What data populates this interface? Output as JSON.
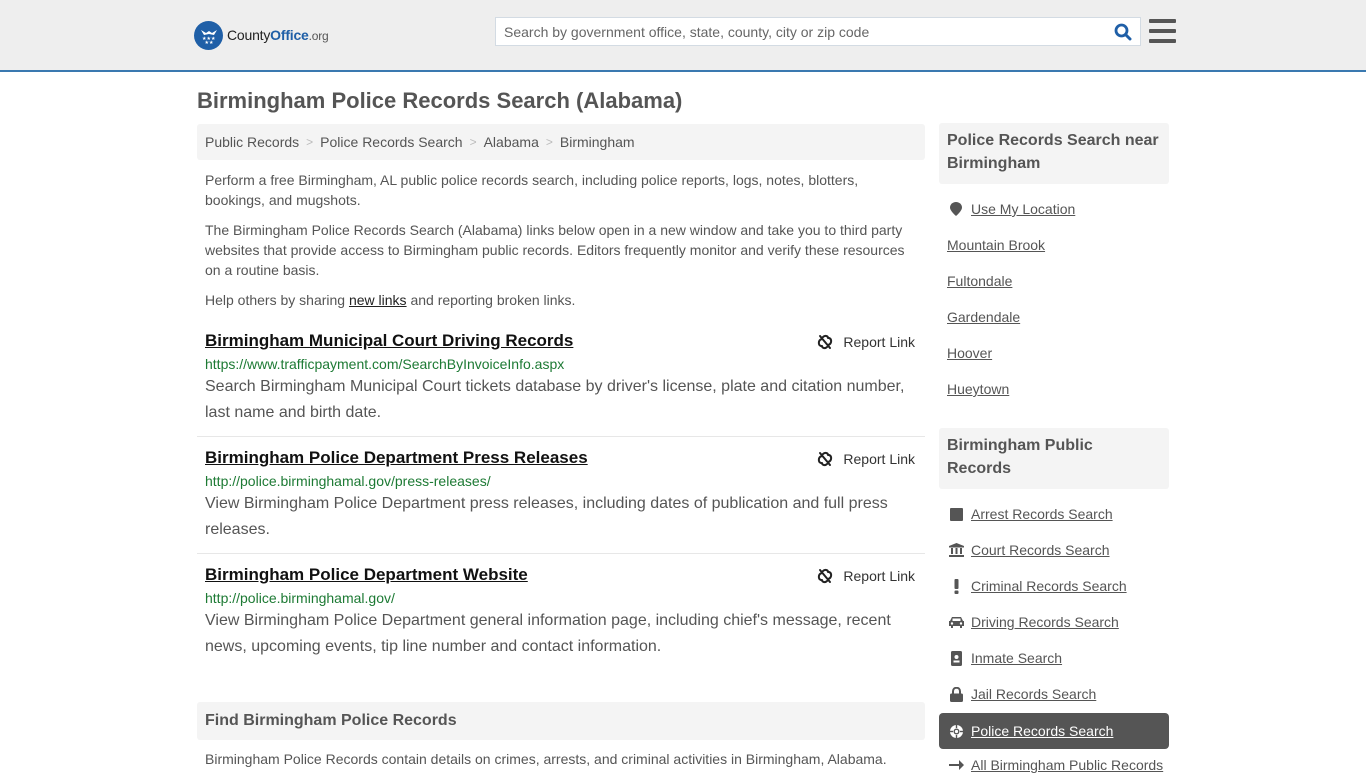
{
  "header": {
    "logo": {
      "county": "County",
      "office": "Office",
      "org": ".org"
    },
    "search_placeholder": "Search by government office, state, county, city or zip code",
    "search_icon": "search-icon",
    "menu_icon": "hamburger-menu-icon",
    "accent_color": "#1f5fa7",
    "border_color": "#3a79b0"
  },
  "page_title": "Birmingham Police Records Search (Alabama)",
  "breadcrumb": [
    "Public Records",
    "Police Records Search",
    "Alabama",
    "Birmingham"
  ],
  "intro": {
    "p1": "Perform a free Birmingham, AL public police records search, including police reports, logs, notes, blotters, bookings, and mugshots.",
    "p2": "The Birmingham Police Records Search (Alabama) links below open in a new window and take you to third party websites that provide access to Birmingham public records. Editors frequently monitor and verify these resources on a routine basis.",
    "p3_before": "Help others by sharing ",
    "p3_link": "new links",
    "p3_after": " and reporting broken links."
  },
  "results": [
    {
      "title": "Birmingham Municipal Court Driving Records",
      "url": "https://www.trafficpayment.com/SearchByInvoiceInfo.aspx",
      "description": "Search Birmingham Municipal Court tickets database by driver's license, plate and citation number, last name and birth date.",
      "report_label": "Report Link"
    },
    {
      "title": "Birmingham Police Department Press Releases",
      "url": "http://police.birminghamal.gov/press-releases/",
      "description": "View Birmingham Police Department press releases, including dates of publication and full press releases.",
      "report_label": "Report Link"
    },
    {
      "title": "Birmingham Police Department Website",
      "url": "http://police.birminghamal.gov/",
      "description": "View Birmingham Police Department general information page, including chief's message, recent news, upcoming events, tip line number and contact information.",
      "report_label": "Report Link"
    }
  ],
  "find_section": {
    "heading": "Find Birmingham Police Records",
    "text": "Birmingham Police Records contain details on crimes, arrests, and criminal activities in Birmingham, Alabama."
  },
  "sidebar": {
    "nearby": {
      "heading": "Police Records Search near Birmingham",
      "use_location": "Use My Location",
      "cities": [
        "Mountain Brook",
        "Fultondale",
        "Gardendale",
        "Hoover",
        "Hueytown"
      ]
    },
    "public_records": {
      "heading": "Birmingham Public Records",
      "items": [
        {
          "label": "Arrest Records Search",
          "icon": "square-icon"
        },
        {
          "label": "Court Records Search",
          "icon": "courthouse-icon"
        },
        {
          "label": "Criminal Records Search",
          "icon": "exclamation-icon"
        },
        {
          "label": "Driving Records Search",
          "icon": "car-icon"
        },
        {
          "label": "Inmate Search",
          "icon": "id-badge-icon"
        },
        {
          "label": "Jail Records Search",
          "icon": "lock-icon"
        },
        {
          "label": "Police Records Search",
          "icon": "crosshairs-icon",
          "active": true
        },
        {
          "label": "All Birmingham Public Records",
          "icon": "arrow-right-icon"
        }
      ]
    }
  }
}
